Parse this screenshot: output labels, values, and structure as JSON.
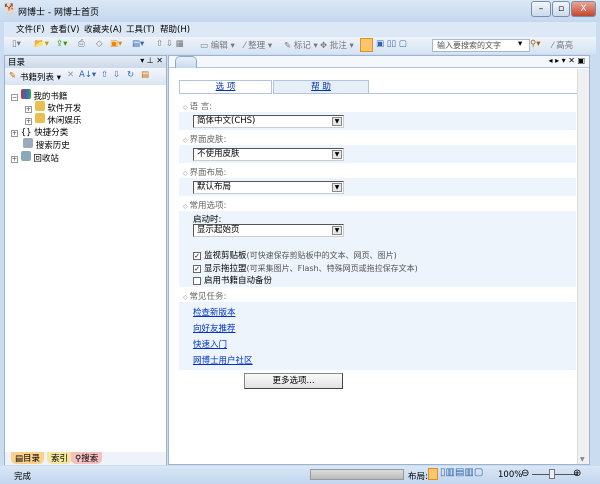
{
  "window": {
    "title": "网博士 - 网博士首页",
    "minimize": "–",
    "maximize": "▫",
    "close": "X"
  },
  "menu": [
    "文件(F)",
    "查看(V)",
    "收藏夹(A)",
    "工具(T)",
    "帮助(H)"
  ],
  "toolbar": {
    "edit": "编辑",
    "organize": "整理",
    "mark": "标记",
    "annotate": "批注",
    "search_placeholder": "输入要搜索的文字",
    "highlight": "高亮"
  },
  "left_panel": {
    "title": "目录",
    "books_list": "书籍列表",
    "tree": [
      {
        "label": "我的书籍"
      },
      {
        "label": "软件开发"
      },
      {
        "label": "休闲娱乐"
      },
      {
        "label": "快捷分类"
      },
      {
        "label": "搜索历史"
      },
      {
        "label": "回收站"
      }
    ],
    "tabs": [
      "目录",
      "索引",
      "搜索"
    ]
  },
  "main": {
    "tabs": [
      "选 项",
      "帮 助"
    ],
    "language": {
      "label": "语 言:",
      "value": "简体中文(CHS)"
    },
    "skin": {
      "label": "界面皮肤:",
      "value": "不使用皮肤"
    },
    "layout": {
      "label": "界面布局:",
      "value": "默认布局"
    },
    "common": {
      "label": "常用选项:",
      "startup_label": "启动时:",
      "startup_value": "显示起始页",
      "checkboxes": [
        {
          "label": "监视剪贴板",
          "hint": "(可快速保存剪贴板中的文本、网页、图片)",
          "checked": true
        },
        {
          "label": "显示拖拉盟",
          "hint": "(可采集图片、Flash、特殊网页或拖拉保存文本)",
          "checked": true
        },
        {
          "label": "启用书籍自动备份",
          "hint": "",
          "checked": false
        }
      ]
    },
    "tasks": {
      "label": "常见任务:",
      "links": [
        "检查新版本",
        "向好友推荐",
        "快速入门",
        "网博士用户社区"
      ]
    },
    "more_button": "更多选项..."
  },
  "status": {
    "text": "完成",
    "layout_label": "布局:",
    "zoom": "100%",
    "zoom_value": 100
  }
}
